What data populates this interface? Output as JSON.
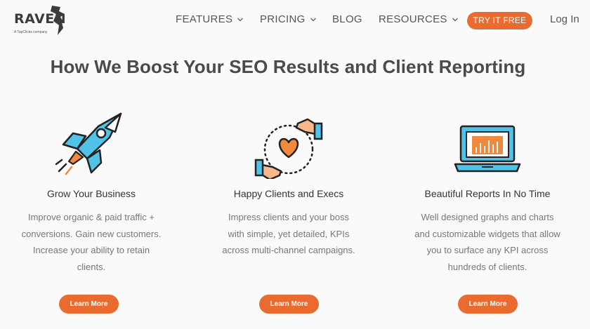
{
  "brand": {
    "name": "RAVEN",
    "tagline": "A TapClicks company"
  },
  "nav": {
    "items": [
      {
        "label": "FEATURES",
        "dropdown": true
      },
      {
        "label": "PRICING",
        "dropdown": true
      },
      {
        "label": "BLOG",
        "dropdown": false
      },
      {
        "label": "RESOURCES",
        "dropdown": true
      }
    ],
    "cta_label": "TRY IT FREE",
    "login_label": "Log In"
  },
  "headline": "How We Boost Your SEO Results and Client Reporting",
  "features": [
    {
      "icon": "rocket-icon",
      "title": "Grow Your Business",
      "lines": [
        "Improve organic & paid traffic +",
        "conversions. Gain new customers.",
        "Increase your ability to retain",
        "clients."
      ],
      "button": "Learn More"
    },
    {
      "icon": "hands-heart-icon",
      "title": "Happy Clients and Execs",
      "lines": [
        "Impress clients and your boss",
        "with simple, yet detailed, KPIs",
        "across multi-channel campaigns."
      ],
      "button": "Learn More"
    },
    {
      "icon": "laptop-chart-icon",
      "title": "Beautiful Reports In No Time",
      "lines": [
        "Well designed graphs and charts",
        "and customizable widgets that allow",
        "you to surface any KPI across",
        "hundreds of clients."
      ],
      "button": "Learn More"
    }
  ],
  "colors": {
    "accent": "#ea6b2f",
    "icon_blue": "#4fc3e8",
    "icon_orange": "#f0883e",
    "icon_peach": "#f7b98a",
    "text_dark": "#4a4a4a"
  }
}
